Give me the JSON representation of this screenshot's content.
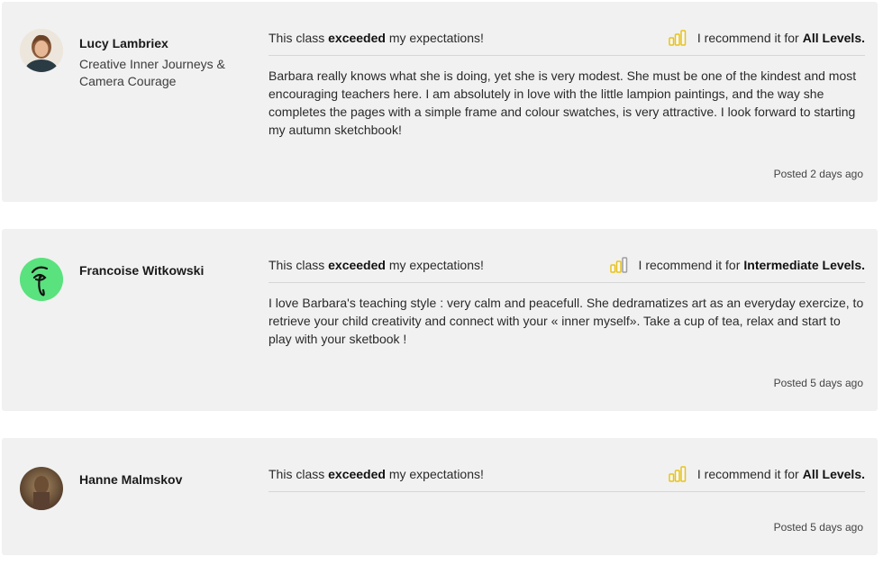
{
  "colors": {
    "card_bg": "#f1f1f1",
    "level_bar_active": "#e8c21a",
    "level_bar_outline": "#bdbdbd",
    "divider": "#d6d6d6"
  },
  "reviews": [
    {
      "author": "Lucy Lambriex",
      "class_name": "Creative Inner Journeys & Camera Courage",
      "headline_prefix": "This class",
      "headline_bold": "exceeded",
      "headline_suffix": "my expectations!",
      "recommend_prefix": "I recommend it for",
      "level": "All Levels.",
      "level_bars_filled": 3,
      "text": "Barbara really knows what she is doing, yet she is very modest. She must be one of the kindest and most encouraging teachers here. I am absolutely in love with the little lampion paintings, and the way she completes the pages with a simple frame and colour swatches, is very attractive. I look forward to starting my autumn sketchbook!",
      "posted": "Posted 2 days ago",
      "avatar_icon": "woman-portrait-avatar"
    },
    {
      "author": "Francoise Witkowski",
      "class_name": "",
      "headline_prefix": "This class",
      "headline_bold": "exceeded",
      "headline_suffix": "my expectations!",
      "recommend_prefix": "I recommend it for",
      "level": "Intermediate Levels.",
      "level_bars_filled": 2,
      "text": "I love Barbara's teaching style : very calm and peacefull. She dedramatizes art as an everyday exercize, to retrieve your child creativity and connect with your « inner myself». Take a cup of tea, relax and start to play with your sketbook !",
      "posted": "Posted 5 days ago",
      "avatar_icon": "green-face-drawing-avatar"
    },
    {
      "author": "Hanne Malmskov",
      "class_name": "",
      "headline_prefix": "This class",
      "headline_bold": "exceeded",
      "headline_suffix": "my expectations!",
      "recommend_prefix": "I recommend it for",
      "level": "All Levels.",
      "level_bars_filled": 3,
      "text": "",
      "posted": "Posted 5 days ago",
      "avatar_icon": "brown-photo-avatar"
    }
  ]
}
